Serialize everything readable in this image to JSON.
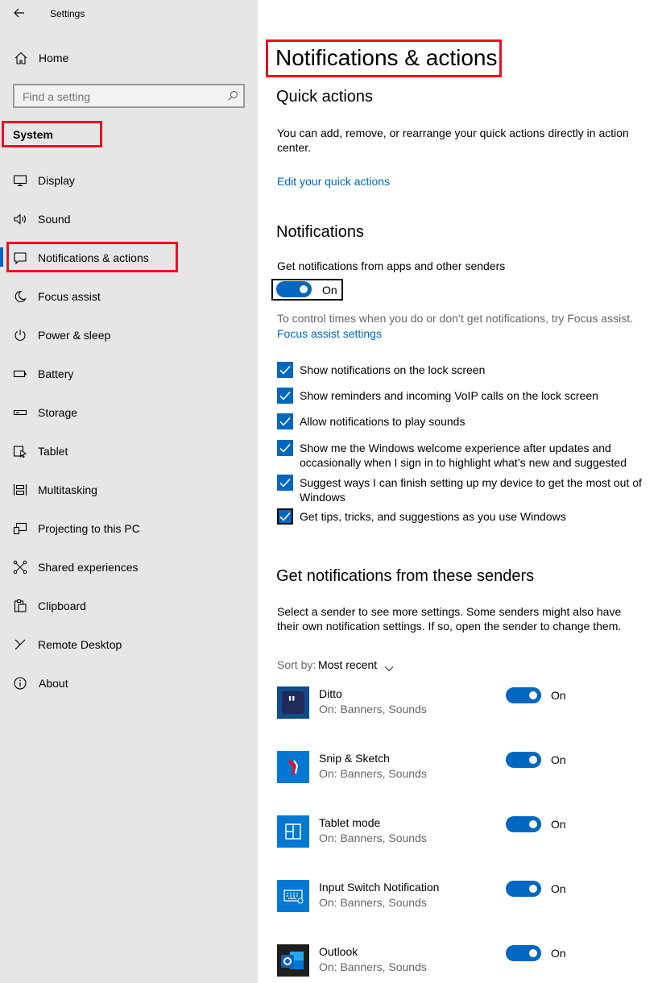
{
  "window": {
    "title": "Settings"
  },
  "sidebar": {
    "home_label": "Home",
    "search": {
      "placeholder": "Find a setting",
      "value": ""
    },
    "section_label": "System",
    "items": [
      {
        "label": "Display",
        "icon": "monitor-icon"
      },
      {
        "label": "Sound",
        "icon": "speaker-icon"
      },
      {
        "label": "Notifications & actions",
        "icon": "message-icon",
        "selected": true
      },
      {
        "label": "Focus assist",
        "icon": "moon-icon"
      },
      {
        "label": "Power & sleep",
        "icon": "power-icon"
      },
      {
        "label": "Battery",
        "icon": "battery-icon"
      },
      {
        "label": "Storage",
        "icon": "storage-icon"
      },
      {
        "label": "Tablet",
        "icon": "tablet-icon"
      },
      {
        "label": "Multitasking",
        "icon": "multitasking-icon"
      },
      {
        "label": "Projecting to this PC",
        "icon": "projecting-icon"
      },
      {
        "label": "Shared experiences",
        "icon": "shared-icon"
      },
      {
        "label": "Clipboard",
        "icon": "clipboard-icon"
      },
      {
        "label": "Remote Desktop",
        "icon": "remote-desktop-icon"
      },
      {
        "label": "About",
        "icon": "info-icon"
      }
    ]
  },
  "main": {
    "page_title": "Notifications & actions",
    "quick_actions": {
      "heading": "Quick actions",
      "description": "You can add, remove, or rearrange your quick actions directly in action center.",
      "link": "Edit your quick actions"
    },
    "notifications": {
      "heading": "Notifications",
      "toggle_label": "Get notifications from apps and other senders",
      "toggle_state": "On",
      "focus_text": "To control times when you do or don’t get notifications, try Focus assist.",
      "focus_link": "Focus assist settings",
      "checkboxes": [
        {
          "label": "Show notifications on the lock screen",
          "checked": true
        },
        {
          "label": "Show reminders and incoming VoIP calls on the lock screen",
          "checked": true
        },
        {
          "label": "Allow notifications to play sounds",
          "checked": true
        },
        {
          "label": "Show me the Windows welcome experience after updates and occasionally when I sign in to highlight what’s new and suggested",
          "checked": true
        },
        {
          "label": "Suggest ways I can finish setting up my device to get the most out of Windows",
          "checked": true
        },
        {
          "label": "Get tips, tricks, and suggestions as you use Windows",
          "checked": true
        }
      ]
    },
    "senders": {
      "heading": "Get notifications from these senders",
      "description": "Select a sender to see more settings. Some senders might also have their own notification settings. If so, open the sender to change them.",
      "sort_label": "Sort by:",
      "sort_value": "Most recent",
      "items": [
        {
          "name": "Ditto",
          "status": "On: Banners, Sounds",
          "toggle": "On",
          "icon": "ditto-icon"
        },
        {
          "name": "Snip & Sketch",
          "status": "On: Banners, Sounds",
          "toggle": "On",
          "icon": "snip-sketch-icon"
        },
        {
          "name": "Tablet mode",
          "status": "On: Banners, Sounds",
          "toggle": "On",
          "icon": "tablet-mode-icon"
        },
        {
          "name": "Input Switch Notification",
          "status": "On: Banners, Sounds",
          "toggle": "On",
          "icon": "keyboard-icon"
        },
        {
          "name": "Outlook",
          "status": "On: Banners, Sounds",
          "toggle": "On",
          "icon": "outlook-icon"
        }
      ]
    }
  },
  "colors": {
    "accent": "#0067c0",
    "highlight_box": "#e81123",
    "sidebar_bg": "#e6e6e6"
  }
}
